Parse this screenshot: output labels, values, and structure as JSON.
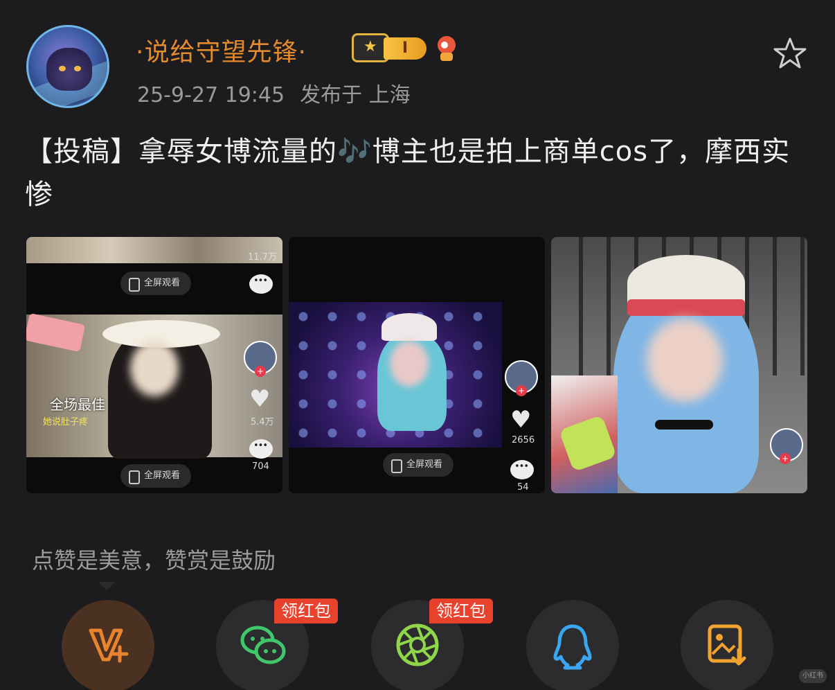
{
  "author": {
    "name": "·说给守望先锋·",
    "level": "I",
    "avatar_icon": "avatar-image",
    "badge_icon": "crown-badge-icon",
    "mascot_icon": "mascot-icon"
  },
  "post": {
    "date": "25-9-27 19:45",
    "location": "发布于 上海",
    "text": "【投稿】拿辱女博流量的🎶博主也是拍上商单cos了，摩西实惨"
  },
  "media": [
    {
      "fullscreen_label_top": "全屏观看",
      "fullscreen_label_bottom": "全屏观看",
      "views": "11.7万",
      "caption_big": "全场最佳",
      "caption_small": "她说肚子疼",
      "likes": "5.4万",
      "comments": "704"
    },
    {
      "fullscreen_label": "全屏观看",
      "likes": "2656",
      "comments": "54"
    },
    {}
  ],
  "reward_note": "点赞是美意，赞赏是鼓励",
  "share": {
    "buttons": [
      {
        "icon": "vip-plus-icon"
      },
      {
        "icon": "wechat-icon",
        "tag": "领红包"
      },
      {
        "icon": "moments-icon",
        "tag": "领红包"
      },
      {
        "icon": "qq-icon"
      },
      {
        "icon": "save-image-icon"
      }
    ]
  },
  "watermark": "小红书",
  "colors": {
    "background": "#1c1c1e",
    "username": "#e48a2e",
    "meta": "#9a9a9a",
    "tag_red": "#e8412c"
  }
}
